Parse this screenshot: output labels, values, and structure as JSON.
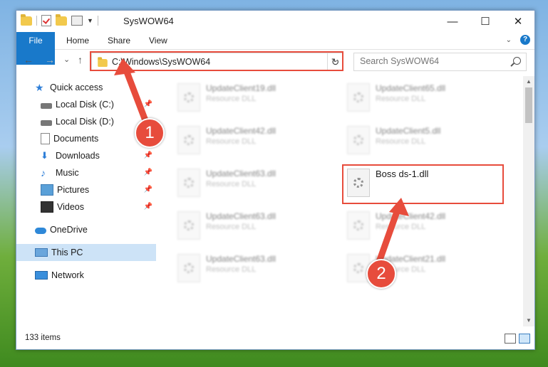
{
  "window": {
    "title": "SysWOW64",
    "controls": {
      "minimize": "—",
      "maximize": "☐",
      "close": "✕"
    }
  },
  "ribbon": {
    "tabs": [
      "File",
      "Home",
      "Share",
      "View"
    ],
    "help": "?"
  },
  "nav": {
    "back": "←",
    "forward": "→",
    "recent": "⌄",
    "up": "↑",
    "address": "C:\\Windows\\SysWOW64",
    "refresh": "↻",
    "search_placeholder": "Search SysWOW64"
  },
  "sidebar": {
    "items": [
      {
        "label": "Quick access",
        "icon": "star-icon"
      },
      {
        "label": "Local Disk (C:)",
        "icon": "disk-icon",
        "pinned": true
      },
      {
        "label": "Local Disk (D:)",
        "icon": "disk-icon"
      },
      {
        "label": "Documents",
        "icon": "documents-icon"
      },
      {
        "label": "Downloads",
        "icon": "download-icon",
        "pinned": true
      },
      {
        "label": "Music",
        "icon": "music-icon",
        "pinned": true
      },
      {
        "label": "Pictures",
        "icon": "pictures-icon",
        "pinned": true
      },
      {
        "label": "Videos",
        "icon": "videos-icon",
        "pinned": true
      },
      {
        "label": "OneDrive",
        "icon": "cloud-icon"
      },
      {
        "label": "This PC",
        "icon": "computer-icon",
        "selected": true
      },
      {
        "label": "Network",
        "icon": "network-icon"
      }
    ]
  },
  "files": [
    {
      "name": "UpdateClient19.dll",
      "type": "Resource DLL",
      "blurred": true
    },
    {
      "name": "UpdateClient65.dll",
      "type": "Resource DLL",
      "blurred": true
    },
    {
      "name": "UpdateClient42.dll",
      "type": "Resource DLL",
      "blurred": true
    },
    {
      "name": "UpdateClient5.dll",
      "type": "Resource DLL",
      "blurred": true
    },
    {
      "name": "UpdateClient63.dll",
      "type": "Resource DLL",
      "blurred": true
    },
    {
      "name": "Boss ds-1.dll",
      "type": "",
      "blurred": false
    },
    {
      "name": "UpdateClient63.dll",
      "type": "Resource DLL",
      "blurred": true
    },
    {
      "name": "UpdateClient42.dll",
      "type": "Resource DLL",
      "blurred": true
    },
    {
      "name": "UpdateClient63.dll",
      "type": "Resource DLL",
      "blurred": true
    },
    {
      "name": "UpdateClient21.dll",
      "type": "Resource DLL",
      "blurred": true
    }
  ],
  "status": {
    "item_count": "133 items"
  },
  "callouts": [
    "1",
    "2"
  ],
  "colors": {
    "accent": "#1979ca",
    "highlight": "#e74c3c",
    "selected": "#cde3f7"
  }
}
